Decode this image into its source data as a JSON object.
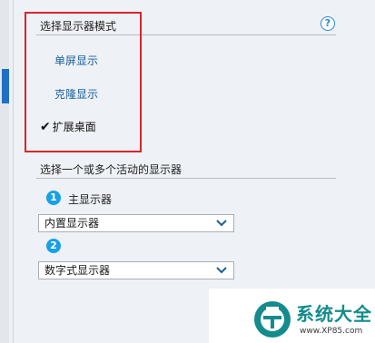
{
  "display_mode": {
    "title": "选择显示器模式",
    "help_symbol": "?",
    "options": [
      {
        "label": "单屏显示",
        "selected": false
      },
      {
        "label": "克隆显示",
        "selected": false
      },
      {
        "label": "扩展桌面",
        "selected": true
      }
    ],
    "check_symbol": "✔"
  },
  "active_displays": {
    "title": "选择一个或多个活动的显示器",
    "steps": [
      {
        "number": "1",
        "label": "主显示器",
        "selected_value": "内置显示器"
      },
      {
        "number": "2",
        "label": "",
        "selected_value": "数字式显示器"
      }
    ]
  },
  "watermark": {
    "text": "系统大全",
    "url": "www.XP85.com"
  },
  "colors": {
    "accent": "#1f6fc4",
    "badge": "#18a0e6",
    "highlight_border": "#d7262a",
    "link": "#1b5f9a",
    "watermark": "#148b8c"
  }
}
